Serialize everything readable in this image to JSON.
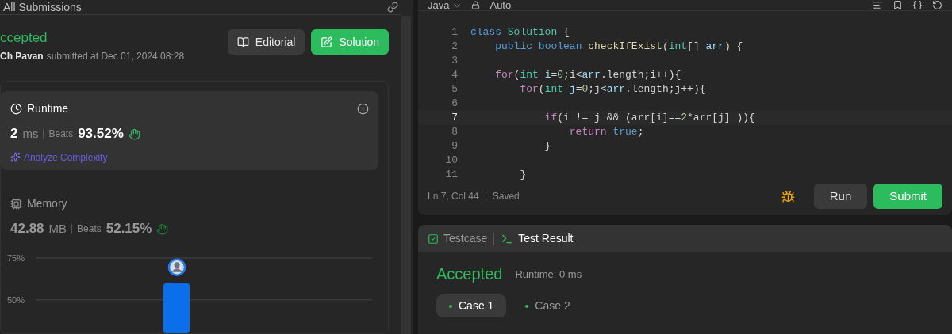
{
  "left_panel": {
    "title": "All Submissions",
    "status": "ccepted",
    "author": "Ch Pavan",
    "submitted_text": "submitted at Dec 01, 2024 08:28",
    "buttons": [
      {
        "label": "Editorial",
        "kind": "secondary"
      },
      {
        "label": "Solution",
        "kind": "primary"
      }
    ],
    "metrics": [
      {
        "title": "Runtime",
        "kind": "time",
        "value": "2",
        "unit": "ms",
        "beats_label": "Beats",
        "beats": "93.52%",
        "selected": true,
        "link": "Analyze Complexity"
      },
      {
        "title": "Memory",
        "kind": "memory",
        "value": "42.88",
        "unit": "MB",
        "beats_label": "Beats",
        "beats": "52.15%",
        "selected": false
      }
    ],
    "chart_data": {
      "type": "bar",
      "values": [
        60
      ],
      "ylim": [
        30,
        75
      ],
      "yticks": [
        {
          "value": 50,
          "label": "50%"
        },
        {
          "value": 75,
          "label": "75%"
        }
      ]
    }
  },
  "editor": {
    "language": "Java",
    "mode": "Auto",
    "lines": [
      {
        "number": "1",
        "current": false,
        "tokens": [
          {
            "text": "class ",
            "kind": "keyword"
          },
          {
            "text": "Solution",
            "kind": "type"
          },
          {
            "text": " {",
            "kind": "plain"
          }
        ]
      },
      {
        "number": "2",
        "current": false,
        "tokens": [
          {
            "text": "    public ",
            "kind": "keyword"
          },
          {
            "text": "boolean ",
            "kind": "keyword"
          },
          {
            "text": "checkIfExist",
            "kind": "func"
          },
          {
            "text": "(",
            "kind": "plain"
          },
          {
            "text": "int",
            "kind": "type"
          },
          {
            "text": "[] ",
            "kind": "plain"
          },
          {
            "text": "arr",
            "kind": "var"
          },
          {
            "text": ") {",
            "kind": "plain"
          }
        ]
      },
      {
        "number": "3",
        "current": false
      },
      {
        "number": "4",
        "current": false,
        "tokens": [
          {
            "text": "    for",
            "kind": "control"
          },
          {
            "text": "(",
            "kind": "plain"
          },
          {
            "text": "int ",
            "kind": "type"
          },
          {
            "text": "i",
            "kind": "var"
          },
          {
            "text": "=",
            "kind": "plain"
          },
          {
            "text": "0",
            "kind": "number"
          },
          {
            "text": ";i<",
            "kind": "plain"
          },
          {
            "text": "arr",
            "kind": "var"
          },
          {
            "text": ".length;i++){",
            "kind": "plain"
          }
        ]
      },
      {
        "number": "5",
        "current": false,
        "tokens": [
          {
            "text": "        for",
            "kind": "control"
          },
          {
            "text": "(",
            "kind": "plain"
          },
          {
            "text": "int ",
            "kind": "type"
          },
          {
            "text": "j",
            "kind": "var"
          },
          {
            "text": "=",
            "kind": "plain"
          },
          {
            "text": "0",
            "kind": "number"
          },
          {
            "text": ";j<",
            "kind": "plain"
          },
          {
            "text": "arr",
            "kind": "var"
          },
          {
            "text": ".length;j++){",
            "kind": "plain"
          }
        ]
      },
      {
        "number": "6",
        "current": false
      },
      {
        "number": "7",
        "current": true,
        "tokens": [
          {
            "text": "            if",
            "kind": "control"
          },
          {
            "text": "(i != j && (arr[i]==",
            "kind": "plain"
          },
          {
            "text": "2",
            "kind": "number"
          },
          {
            "text": "*arr[j] )){",
            "kind": "plain"
          }
        ]
      },
      {
        "number": "8",
        "current": false,
        "tokens": [
          {
            "text": "                return ",
            "kind": "control"
          },
          {
            "text": "true",
            "kind": "keyword"
          },
          {
            "text": ";",
            "kind": "plain"
          }
        ]
      },
      {
        "number": "9",
        "current": false,
        "tokens": [
          {
            "text": "            }",
            "kind": "plain"
          }
        ]
      },
      {
        "number": "10",
        "current": false
      },
      {
        "number": "11",
        "current": false,
        "tokens": [
          {
            "text": "        }",
            "kind": "plain"
          }
        ]
      }
    ],
    "status": {
      "position": "Ln 7, Col 44",
      "saved": "Saved"
    },
    "buttons": [
      {
        "label": "Run",
        "kind": "secondary"
      },
      {
        "label": "Submit",
        "kind": "primary"
      }
    ]
  },
  "result_panel": {
    "tabs": [
      {
        "label": "Testcase",
        "kind": "testcase",
        "selected": false
      },
      {
        "label": "Test Result",
        "kind": "result",
        "selected": true
      }
    ],
    "verdict": "Accepted",
    "runtime": "Runtime: 0 ms",
    "cases": [
      {
        "label": "Case 1",
        "selected": true
      },
      {
        "label": "Case 2",
        "selected": false
      }
    ]
  }
}
